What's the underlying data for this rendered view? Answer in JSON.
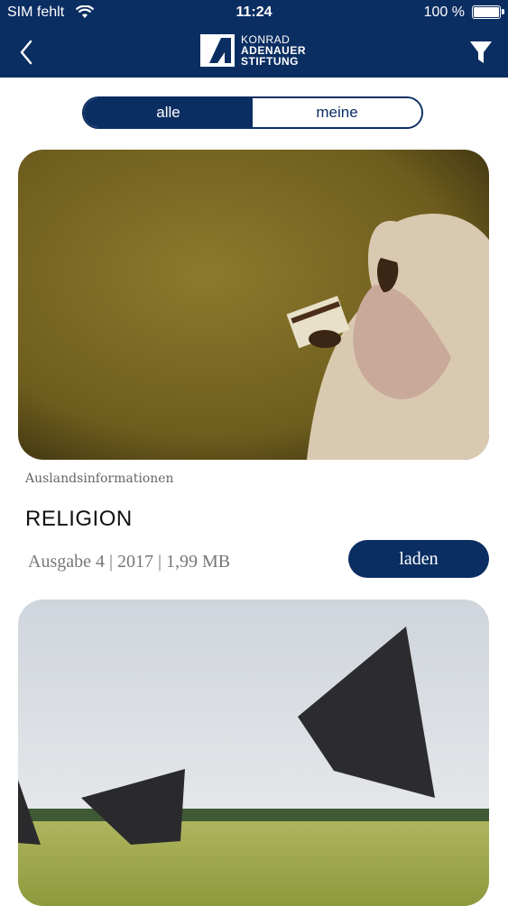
{
  "status_bar": {
    "carrier": "SIM fehlt",
    "time": "11:24",
    "battery": "100 %"
  },
  "header": {
    "logo": {
      "line1": "KONRAD",
      "line2": "ADENAUER",
      "line3": "STIFTUNG"
    },
    "icons": {
      "back": "back-chevron-icon",
      "filter": "filter-icon"
    }
  },
  "segmented": {
    "all_label": "alle",
    "mine_label": "meine",
    "selected": "alle"
  },
  "items": [
    {
      "category": "Auslandsinformationen",
      "title": "RELIGION",
      "meta": "Ausgabe 4 | 2017 | 1,99 MB",
      "button_label": "laden"
    }
  ],
  "colors": {
    "brand": "#0b2e62",
    "background": "#ffffff"
  }
}
